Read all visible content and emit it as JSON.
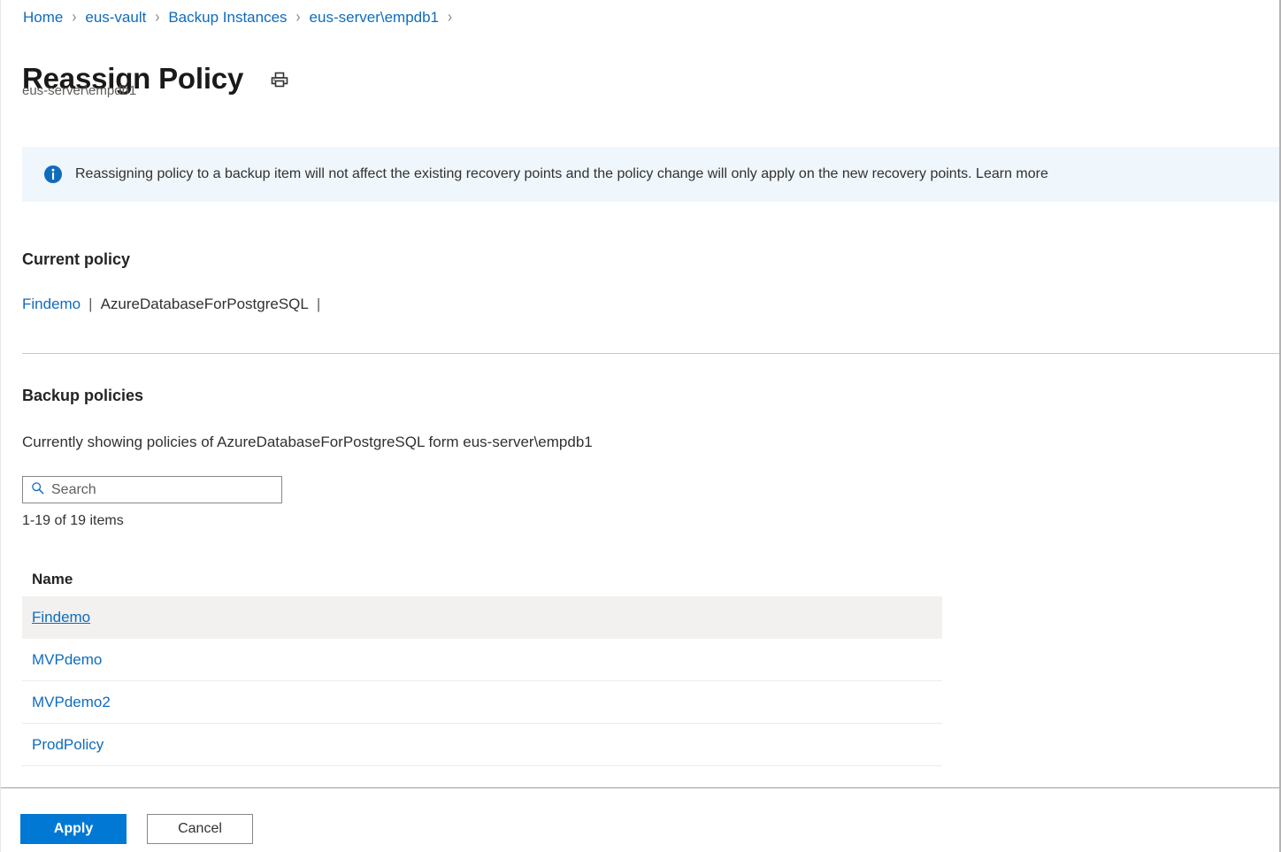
{
  "breadcrumb": {
    "separator": "›",
    "items": [
      {
        "label": "Home",
        "name": "breadcrumb-home"
      },
      {
        "label": "eus-vault",
        "name": "breadcrumb-eus-vault"
      },
      {
        "label": "Backup Instances",
        "name": "breadcrumb-backup-instances"
      },
      {
        "label": "eus-server\\empdb1",
        "name": "breadcrumb-eus-server-empdb1"
      }
    ]
  },
  "header": {
    "title": "Reassign Policy",
    "subtitle": "eus-server\\empdb1",
    "print_icon": "print-icon"
  },
  "banner": {
    "icon": "info-icon",
    "text": "Reassigning policy to a backup item will not affect the existing recovery points and the policy change will only apply on the new recovery points. Learn more",
    "background": "#eff6fc",
    "icon_color": "#0f6cbd"
  },
  "current_policy": {
    "heading": "Current policy",
    "policy_name": "Findemo",
    "separator": "|",
    "datasource_type": "AzureDatabaseForPostgreSQL",
    "trailing_separator": "|"
  },
  "backup_policies": {
    "heading": "Backup policies",
    "showing_text": "Currently showing policies of AzureDatabaseForPostgreSQL form eus-server\\empdb1",
    "search": {
      "placeholder": "Search",
      "value": "",
      "icon": "search-icon"
    },
    "item_count": "1-19 of 19 items",
    "columns": [
      "Name"
    ],
    "rows": [
      {
        "name": "Findemo",
        "selected": true
      },
      {
        "name": "MVPdemo",
        "selected": false
      },
      {
        "name": "MVPdemo2",
        "selected": false
      },
      {
        "name": "ProdPolicy",
        "selected": false
      }
    ]
  },
  "footer": {
    "apply_label": "Apply",
    "cancel_label": "Cancel",
    "primary_color": "#0078d4"
  }
}
